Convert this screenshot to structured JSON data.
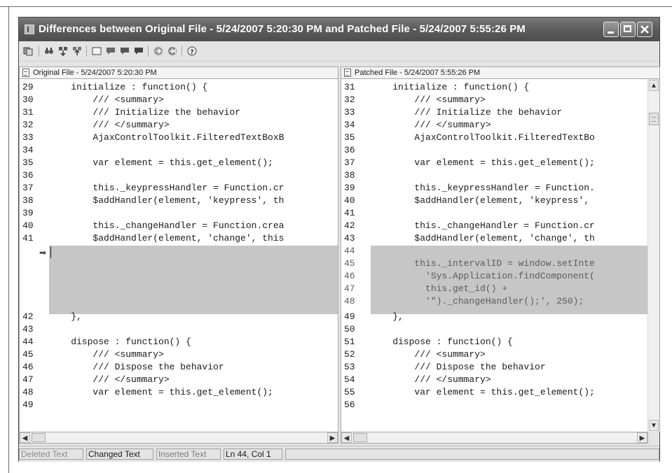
{
  "window": {
    "title": "Differences between Original File - 5/24/2007 5:20:30 PM and Patched File - 5/24/2007 5:55:26 PM"
  },
  "toolbar": {
    "icons": [
      "copy-icon",
      "find-icon",
      "previous-difference-icon",
      "next-difference-icon",
      "blank-page-icon",
      "comment-icon",
      "comment-previous-icon",
      "comment-next-icon",
      "merge-left-icon",
      "merge-right-icon",
      "help-icon"
    ]
  },
  "left_pane": {
    "header": "Original File - 5/24/2007 5:20:30 PM",
    "lines": [
      {
        "num": "29",
        "code": "    initialize : function() {"
      },
      {
        "num": "30",
        "code": "        /// <summary>"
      },
      {
        "num": "31",
        "code": "        /// Initialize the behavior"
      },
      {
        "num": "32",
        "code": "        /// </summary>"
      },
      {
        "num": "33",
        "code": "        AjaxControlToolkit.FilteredTextBoxB"
      },
      {
        "num": "34",
        "code": ""
      },
      {
        "num": "35",
        "code": "        var element = this.get_element();"
      },
      {
        "num": "36",
        "code": ""
      },
      {
        "num": "37",
        "code": "        this._keypressHandler = Function.cr"
      },
      {
        "num": "38",
        "code": "        $addHandler(element, 'keypress', th"
      },
      {
        "num": "39",
        "code": ""
      },
      {
        "num": "40",
        "code": "        this._changeHandler = Function.crea"
      },
      {
        "num": "41",
        "code": "        $addHandler(element, 'change', this"
      }
    ],
    "lines_after": [
      {
        "num": "42",
        "code": "    },"
      },
      {
        "num": "43",
        "code": ""
      },
      {
        "num": "44",
        "code": "    dispose : function() {"
      },
      {
        "num": "45",
        "code": "        /// <summary>"
      },
      {
        "num": "46",
        "code": "        /// Dispose the behavior"
      },
      {
        "num": "47",
        "code": "        /// </summary>"
      },
      {
        "num": "48",
        "code": "        var element = this.get_element();"
      },
      {
        "num": "49",
        "code": ""
      }
    ]
  },
  "right_pane": {
    "header": "Patched File - 5/24/2007 5:55:26 PM",
    "lines": [
      {
        "num": "31",
        "code": "    initialize : function() {"
      },
      {
        "num": "32",
        "code": "        /// <summary>"
      },
      {
        "num": "33",
        "code": "        /// Initialize the behavior"
      },
      {
        "num": "34",
        "code": "        /// </summary>"
      },
      {
        "num": "35",
        "code": "        AjaxControlToolkit.FilteredTextBo"
      },
      {
        "num": "36",
        "code": ""
      },
      {
        "num": "37",
        "code": "        var element = this.get_element();"
      },
      {
        "num": "38",
        "code": ""
      },
      {
        "num": "39",
        "code": "        this._keypressHandler = Function."
      },
      {
        "num": "40",
        "code": "        $addHandler(element, 'keypress', "
      },
      {
        "num": "41",
        "code": ""
      },
      {
        "num": "42",
        "code": "        this._changeHandler = Function.cr"
      },
      {
        "num": "43",
        "code": "        $addHandler(element, 'change', th"
      }
    ],
    "inserted_lines": [
      {
        "num": "44",
        "code": ""
      },
      {
        "num": "45",
        "code": "        this._intervalID = window.setInte"
      },
      {
        "num": "46",
        "code": "          'Sys.Application.findComponent("
      },
      {
        "num": "47",
        "code": "          this.get_id() +"
      },
      {
        "num": "48",
        "code": "          '\")._changeHandler();', 250);"
      }
    ],
    "lines_after": [
      {
        "num": "49",
        "code": "    },"
      },
      {
        "num": "50",
        "code": ""
      },
      {
        "num": "51",
        "code": "    dispose : function() {"
      },
      {
        "num": "52",
        "code": "        /// <summary>"
      },
      {
        "num": "53",
        "code": "        /// Dispose the behavior"
      },
      {
        "num": "54",
        "code": "        /// </summary>"
      },
      {
        "num": "55",
        "code": "        var element = this.get_element();"
      },
      {
        "num": "56",
        "code": ""
      }
    ]
  },
  "status": {
    "deleted": "Deleted Text",
    "changed": "Changed Text",
    "inserted": "Inserted Text",
    "position": "Ln 44, Col 1"
  },
  "colors": {
    "titlebar": "#5e5e5e",
    "window_bg": "#e4e4e4",
    "diff_highlight": "#c6c6c6",
    "deleted_status_text": "#8a8a8a",
    "inserted_status_text": "#7a7a7a"
  }
}
